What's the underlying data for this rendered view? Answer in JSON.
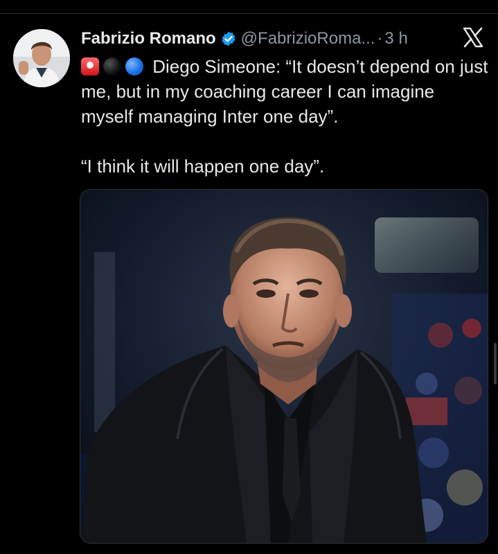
{
  "author": {
    "name": "Fabrizio Romano",
    "handle": "@FabrizioRoma...",
    "separator": "·",
    "time": "3 h"
  },
  "icons": {
    "verified": "verified-badge-icon",
    "platform": "x-logo-icon",
    "emojis": [
      "siren-emoji",
      "black-circle-emoji",
      "blue-circle-emoji"
    ]
  },
  "tweet": {
    "paragraph1": "Diego Simeone: “It doesn’t depend on just me, but in my coaching career I can imagine myself managing Inter one day”.",
    "paragraph2": "“I think it will happen one day”."
  },
  "colors": {
    "background": "#000000",
    "text": "#e7e9ea",
    "muted": "#8b98a5",
    "verified": "#1d9bf0"
  }
}
